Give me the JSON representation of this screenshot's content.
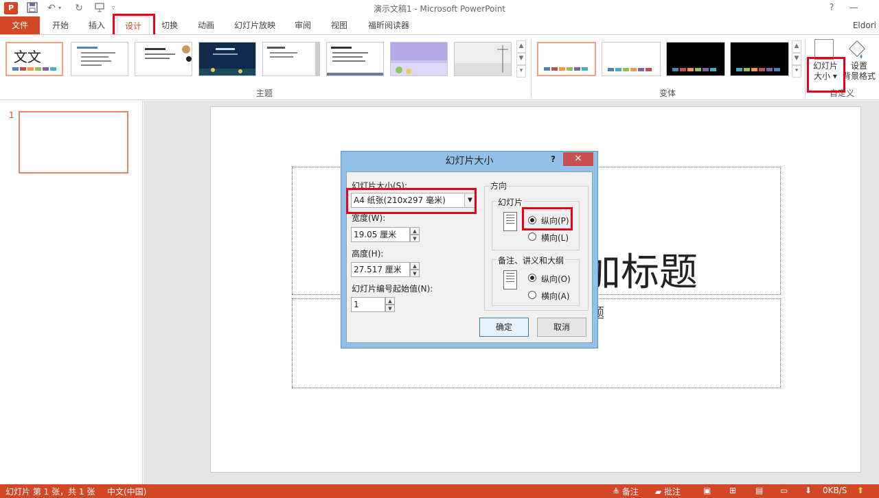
{
  "window": {
    "title": "演示文稿1 - Microsoft PowerPoint",
    "help": "?",
    "minimize": "—"
  },
  "tabs": {
    "file": "文件",
    "items": [
      "开始",
      "插入",
      "设计",
      "切换",
      "动画",
      "幻灯片放映",
      "审阅",
      "视图",
      "福昕阅读器"
    ],
    "active": "设计",
    "user": "Eldori"
  },
  "ribbon": {
    "themes_label": "主题",
    "variants_label": "变体",
    "customize_label": "自定义",
    "theme_first_text": "文文",
    "slide_size_line1": "幻灯片",
    "slide_size_line2": "大小",
    "format_bg_line1": "设置",
    "format_bg_line2": "背景格式",
    "accent_colors": [
      "#4f81bd",
      "#c0504d",
      "#f79646",
      "#9bbb59",
      "#8064a2",
      "#4bacc6"
    ]
  },
  "slides": {
    "number": "1"
  },
  "slide": {
    "title_fragment": "加标题",
    "subtitle_fragment": "题"
  },
  "dialog": {
    "title": "幻灯片大小",
    "help": "?",
    "close": "✕",
    "size_label": "幻灯片大小(S):",
    "size_value": "A4 纸张(210x297 毫米)",
    "width_label": "宽度(W):",
    "width_value": "19.05 厘米",
    "height_label": "高度(H):",
    "height_value": "27.517 厘米",
    "start_label": "幻灯片编号起始值(N):",
    "start_value": "1",
    "orientation_label": "方向",
    "slides_group_label": "幻灯片",
    "portrait_label": "纵向(P)",
    "landscape_label": "横向(L)",
    "notes_group_label": "备注、讲义和大纲",
    "notes_portrait_label": "纵向(O)",
    "notes_landscape_label": "横向(A)",
    "ok": "确定",
    "cancel": "取消"
  },
  "status": {
    "slide_info": "幻灯片 第 1 张，共 1 张",
    "language": "中文(中国)",
    "notes": "备注",
    "comments": "批注",
    "net_speed": "0KB/S"
  }
}
